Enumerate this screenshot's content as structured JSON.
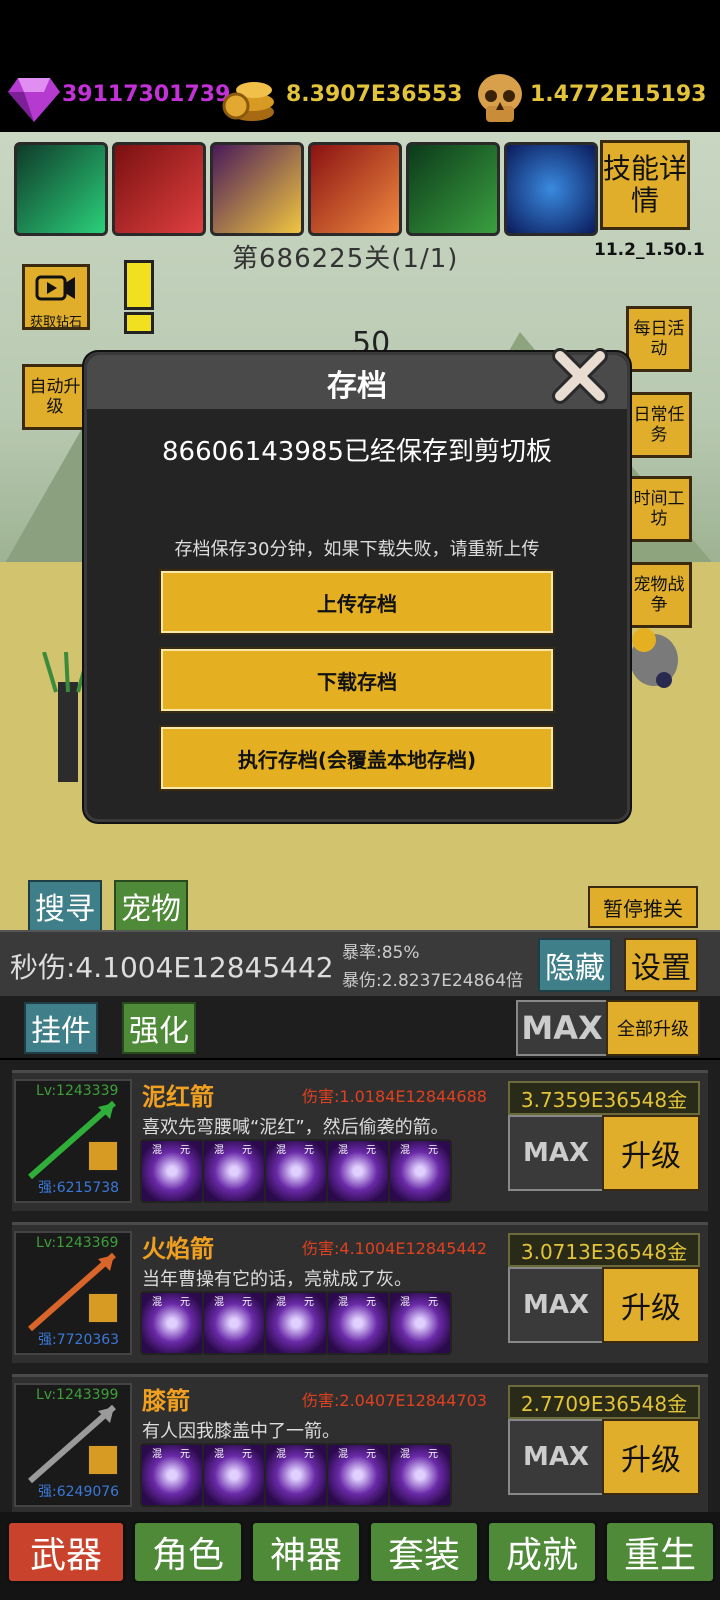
{
  "currency": {
    "gems": "39117301739",
    "gold": "8.3907E36553",
    "skulls": "1.4772E15193"
  },
  "skills": {
    "details_label": "技能详情",
    "version": "11.2_1.50.1"
  },
  "stage": {
    "label": "第686225关(1/1)",
    "counter": "50"
  },
  "left_buttons": {
    "get_diamonds": "获取钻石",
    "auto_upgrade": "自动升级",
    "search": "搜寻",
    "pet": "宠物"
  },
  "right_buttons": {
    "daily_event": "每日活动",
    "daily_task": "日常任务",
    "time_workshop": "时间工坊",
    "pet_war": "宠物战争",
    "pause": "暂停推关"
  },
  "dialog": {
    "title": "存档",
    "message": "86606143985已经保存到剪切板",
    "notice": "存档保存30分钟，如果下载失败，请重新上传",
    "upload": "上传存档",
    "download": "下载存档",
    "execute": "执行存档(会覆盖本地存档)"
  },
  "stats": {
    "dps": "秒伤:4.1004E12845442",
    "crit_rate": "暴率:85%",
    "crit_dmg": "暴伤:2.8237E24864倍",
    "hide": "隐藏",
    "settings": "设置"
  },
  "subtabs": {
    "addon": "挂件",
    "enhance": "强化",
    "max": "MAX",
    "upgrade_all": "全部升级"
  },
  "weapons": [
    {
      "level": "Lv:1243339",
      "strength": "强:6215738",
      "name": "泥红箭",
      "damage": "伤害:1.0184E12844688",
      "desc": "喜欢先弯腰喊“泥红”，然后偷袭的箭。",
      "cost": "3.7359E36548金",
      "max": "MAX",
      "upgrade": "升级",
      "glyph": "JP",
      "color": "#2fae3a"
    },
    {
      "level": "Lv:1243369",
      "strength": "强:7720363",
      "name": "火焰箭",
      "damage": "伤害:4.1004E12845442",
      "desc": "当年曹操有它的话，亮就成了灰。",
      "cost": "3.0713E36548金",
      "max": "MAX",
      "upgrade": "升级",
      "glyph": "",
      "color": "#d9652a"
    },
    {
      "level": "Lv:1243399",
      "strength": "强:6249076",
      "name": "膝箭",
      "damage": "伤害:2.0407E12844703",
      "desc": "有人因我膝盖中了一箭。",
      "cost": "2.7709E36548金",
      "max": "MAX",
      "upgrade": "升级",
      "glyph": "",
      "color": "#9a9a9a"
    }
  ],
  "rune_labels": [
    "混",
    "元"
  ],
  "bottom_tabs": [
    "武器",
    "角色",
    "神器",
    "套装",
    "成就",
    "重生"
  ],
  "colors": {
    "accent_yellow": "#e4b022",
    "gem_purple": "#c531d8",
    "gold_text": "#e2c33a",
    "damage_red": "#e0401e",
    "weapon_name": "#f0a020"
  }
}
